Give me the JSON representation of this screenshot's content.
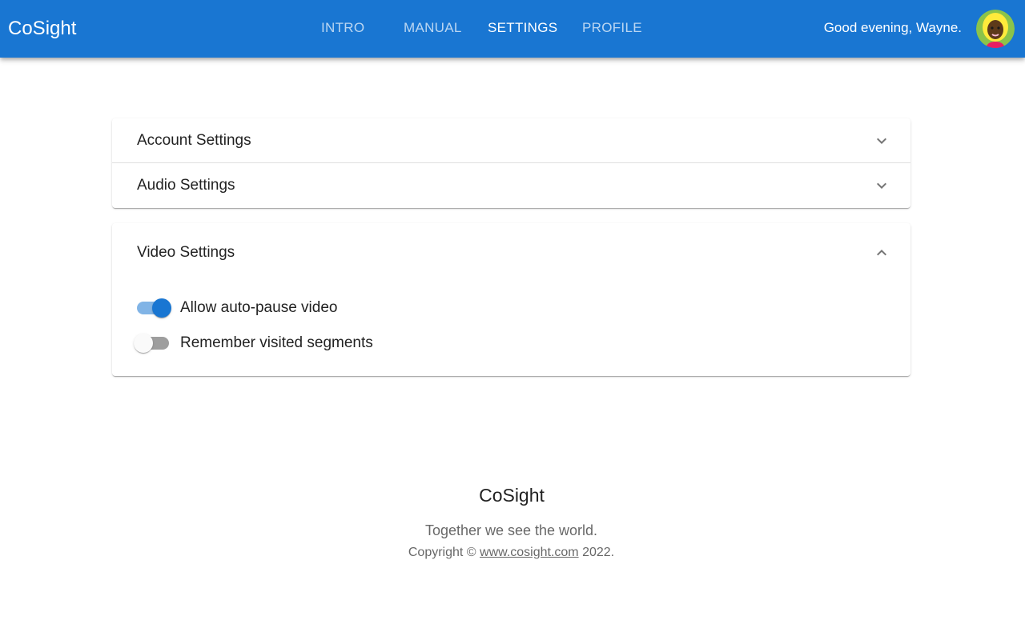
{
  "header": {
    "brand": "CoSight",
    "tabs": [
      {
        "label": "INTRO",
        "active": false
      },
      {
        "label": "MANUAL",
        "active": false
      },
      {
        "label": "SETTINGS",
        "active": true
      },
      {
        "label": "PROFILE",
        "active": false
      }
    ],
    "greeting": "Good evening, Wayne.",
    "avatar_icon": "user-avatar"
  },
  "settings": {
    "account": {
      "title": "Account Settings",
      "expanded": false,
      "icon": "chevron-down-icon"
    },
    "audio": {
      "title": "Audio Settings",
      "expanded": false,
      "icon": "chevron-down-icon"
    },
    "video": {
      "title": "Video Settings",
      "expanded": true,
      "icon": "chevron-up-icon",
      "options": [
        {
          "label": "Allow auto-pause video",
          "checked": true
        },
        {
          "label": "Remember visited segments",
          "checked": false
        }
      ]
    }
  },
  "footer": {
    "brand": "CoSight",
    "tagline": "Together we see the world.",
    "copyright_prefix": "Copyright ©",
    "link_text": "www.cosight.com",
    "copyright_suffix": "2022."
  },
  "colors": {
    "primary": "#1976d2",
    "switch_off_track": "#9e9e9e"
  }
}
